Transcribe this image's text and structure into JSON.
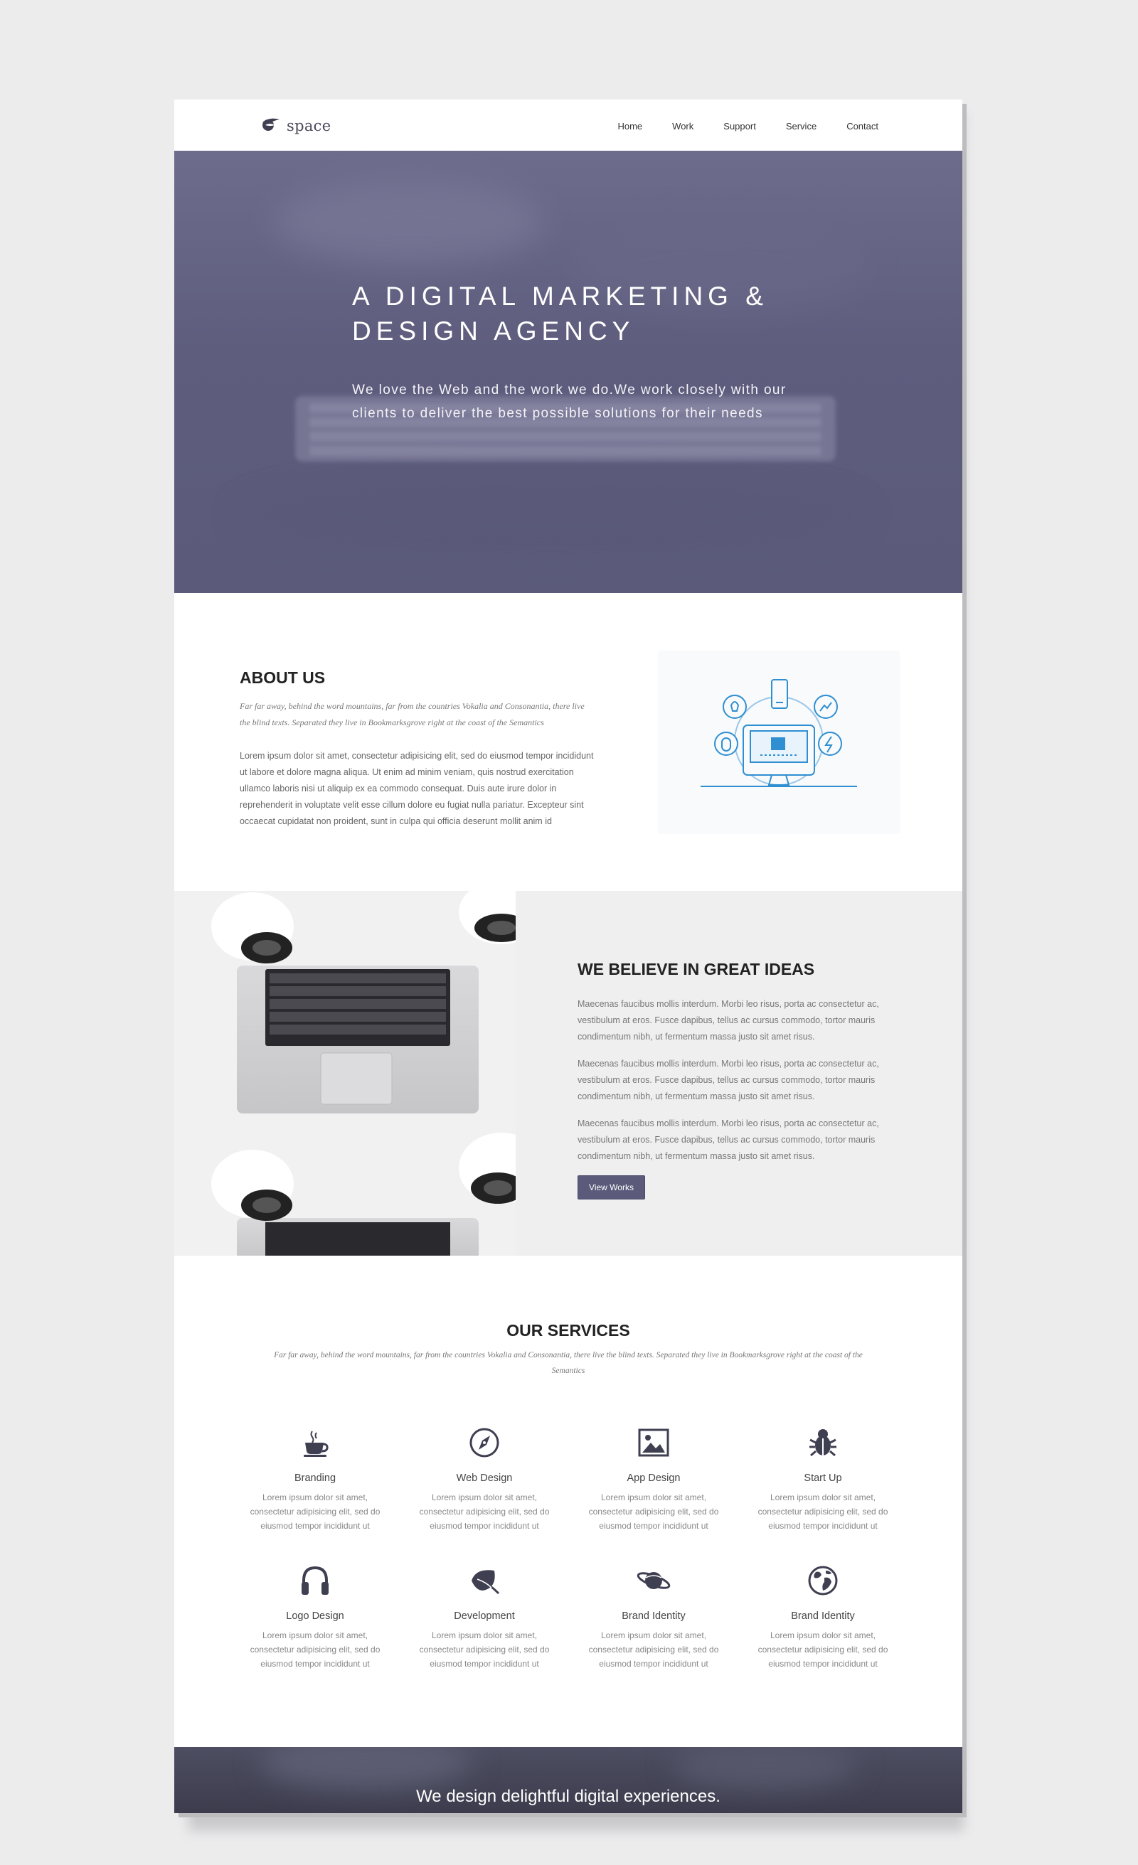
{
  "brand": {
    "name": "space"
  },
  "nav": {
    "items": [
      {
        "label": "Home"
      },
      {
        "label": "Work"
      },
      {
        "label": "Support"
      },
      {
        "label": "Service"
      },
      {
        "label": "Contact"
      }
    ]
  },
  "hero": {
    "title_line1": "A DIGITAL MARKETING &",
    "title_line2": "DESIGN AGENCY",
    "subtitle_line1": "We love the Web and the work we do.We work closely with our",
    "subtitle_line2": "clients to deliver the best possible solutions for their needs"
  },
  "about": {
    "title": "ABOUT US",
    "italic_line1": "Far far away, behind the word mountains, far from the countries Vokalia and Consonantia, there live",
    "italic_line2": "the blind texts. Separated they live in Bookmarksgrove right at the coast of the Semantics",
    "body_lines": [
      "Lorem ipsum dolor sit amet, consectetur adipisicing elit, sed do eiusmod tempor incididunt",
      "ut labore et dolore magna aliqua. Ut enim ad minim veniam, quis nostrud exercitation",
      "ullamco laboris nisi ut aliquip ex ea commodo consequat. Duis aute irure dolor in",
      "reprehenderit in voluptate velit esse cillum dolore eu fugiat nulla pariatur. Excepteur sint",
      "occaecat cupidatat non proident, sunt in culpa qui officia deserunt mollit anim id"
    ],
    "illustration_icon": "computer-devices-illustration"
  },
  "believe": {
    "title": "WE BELIEVE IN GREAT IDEAS",
    "paragraphs": [
      [
        "Maecenas faucibus mollis interdum. Morbi leo risus, porta ac consectetur ac,",
        "vestibulum at eros. Fusce dapibus, tellus ac cursus commodo, tortor mauris",
        "condimentum nibh, ut fermentum massa justo sit amet risus."
      ],
      [
        "Maecenas faucibus mollis interdum. Morbi leo risus, porta ac consectetur ac,",
        "vestibulum at eros. Fusce dapibus, tellus ac cursus commodo, tortor mauris",
        "condimentum nibh, ut fermentum massa justo sit amet risus."
      ],
      [
        "Maecenas faucibus mollis interdum. Morbi leo risus, porta ac consectetur ac,",
        "vestibulum at eros. Fusce dapibus, tellus ac cursus commodo, tortor mauris",
        "condimentum nibh, ut fermentum massa justo sit amet risus."
      ]
    ],
    "button_label": "View Works"
  },
  "services": {
    "title": "OUR SERVICES",
    "italic_line1": "Far far away, behind the word mountains, far from the countries Vokalia and Consonantia, there live the blind texts. Separated they live in Bookmarksgrove right at the coast of the",
    "italic_line2": "Semantics",
    "items": [
      {
        "title": "Branding",
        "icon": "coffee-cup-icon",
        "desc": [
          "Lorem ipsum dolor sit amet,",
          "consectetur adipisicing elit, sed do",
          "eiusmod tempor incididunt ut"
        ]
      },
      {
        "title": "Web Design",
        "icon": "compass-icon",
        "desc": [
          "Lorem ipsum dolor sit amet,",
          "consectetur adipisicing elit, sed do",
          "eiusmod tempor incididunt ut"
        ]
      },
      {
        "title": "App Design",
        "icon": "image-icon",
        "desc": [
          "Lorem ipsum dolor sit amet,",
          "consectetur adipisicing elit, sed do",
          "eiusmod tempor incididunt ut"
        ]
      },
      {
        "title": "Start Up",
        "icon": "bug-icon",
        "desc": [
          "Lorem ipsum dolor sit amet,",
          "consectetur adipisicing elit, sed do",
          "eiusmod tempor incididunt ut"
        ]
      },
      {
        "title": "Logo Design",
        "icon": "headphones-icon",
        "desc": [
          "Lorem ipsum dolor sit amet,",
          "consectetur adipisicing elit, sed do",
          "eiusmod tempor incididunt ut"
        ]
      },
      {
        "title": "Development",
        "icon": "leaf-icon",
        "desc": [
          "Lorem ipsum dolor sit amet,",
          "consectetur adipisicing elit, sed do",
          "eiusmod tempor incididunt ut"
        ]
      },
      {
        "title": "Brand Identity",
        "icon": "planet-icon",
        "desc": [
          "Lorem ipsum dolor sit amet,",
          "consectetur adipisicing elit, sed do",
          "eiusmod tempor incididunt ut"
        ]
      },
      {
        "title": "Brand Identity",
        "icon": "globe-icon",
        "desc": [
          "Lorem ipsum dolor sit amet,",
          "consectetur adipisicing elit, sed do",
          "eiusmod tempor incididunt ut"
        ]
      }
    ]
  },
  "footer": {
    "tagline": "We design delightful digital experiences."
  },
  "colors": {
    "accent": "#5b5a7a",
    "illustration_blue": "#2f8fd1",
    "icon_dark": "#3f3f52"
  }
}
